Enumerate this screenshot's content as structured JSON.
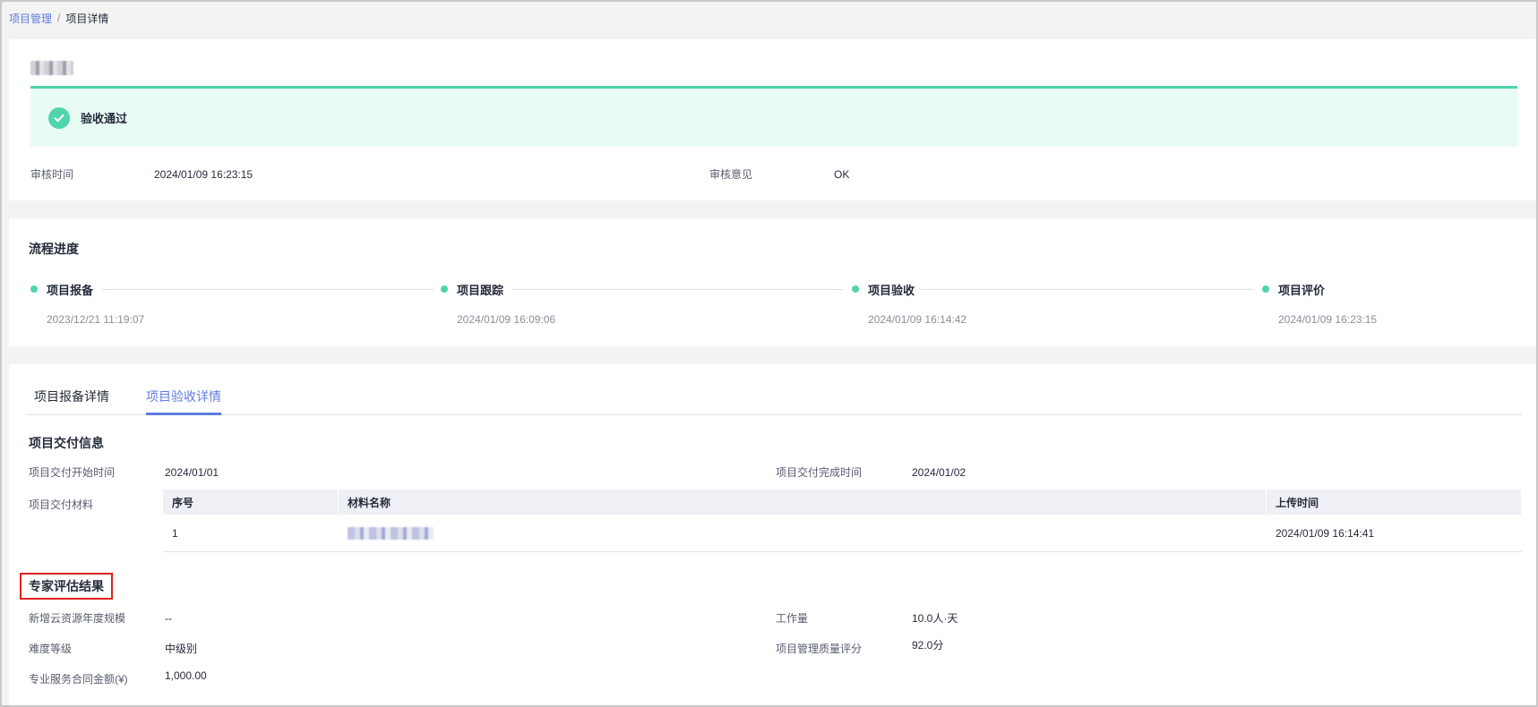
{
  "breadcrumb": {
    "parent": "项目管理",
    "separator": "/",
    "current": "项目详情"
  },
  "status": {
    "label": "验收通过",
    "color": "#50d4ab"
  },
  "review": {
    "time_label": "审核时间",
    "time_value": "2024/01/09 16:23:15",
    "opinion_label": "审核意见",
    "opinion_value": "OK"
  },
  "process": {
    "title": "流程进度",
    "steps": [
      {
        "label": "项目报备",
        "time": "2023/12/21 11:19:07"
      },
      {
        "label": "项目跟踪",
        "time": "2024/01/09 16:09:06"
      },
      {
        "label": "项目验收",
        "time": "2024/01/09 16:14:42"
      },
      {
        "label": "项目评价",
        "time": "2024/01/09 16:23:15"
      }
    ]
  },
  "tabs": [
    {
      "label": "项目报备详情",
      "active": false
    },
    {
      "label": "项目验收详情",
      "active": true
    }
  ],
  "delivery": {
    "title": "项目交付信息",
    "start_label": "项目交付开始时间",
    "start_value": "2024/01/01",
    "end_label": "项目交付完成时间",
    "end_value": "2024/01/02",
    "materials_label": "项目交付材料",
    "table": {
      "columns": [
        "序号",
        "材料名称",
        "上传时间"
      ],
      "rows": [
        {
          "index": "1",
          "upload_time": "2024/01/09 16:14:41"
        }
      ]
    }
  },
  "expert": {
    "title": "专家评估结果",
    "cloud_label": "新增云资源年度规模",
    "cloud_value": "--",
    "workload_label": "工作量",
    "workload_value": "10.0人·天",
    "difficulty_label": "难度等级",
    "difficulty_value": "中级别",
    "quality_label": "项目管理质量评分",
    "quality_value": "92.0分",
    "contract_label": "专业服务合同金额(¥)",
    "contract_value": "1,000.00"
  },
  "colors": {
    "accent": "#5e7ce0",
    "success": "#50d4ab",
    "highlight_border": "#e02020"
  }
}
